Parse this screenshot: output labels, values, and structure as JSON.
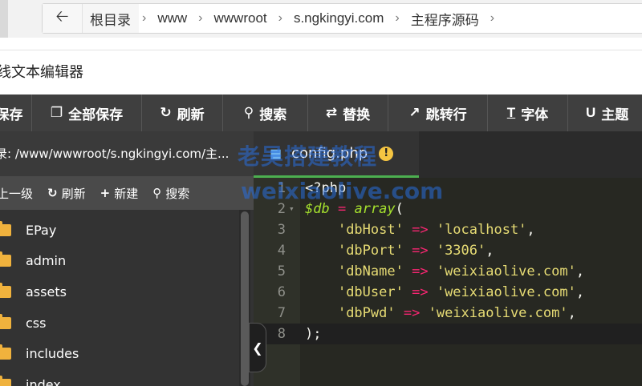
{
  "breadcrumb": {
    "back_icon": "back-arrow-icon",
    "items": [
      "根目录",
      "www",
      "wwwroot",
      "s.ngkingyi.com",
      "主程序源码"
    ]
  },
  "dialog": {
    "title": "线文本编辑器"
  },
  "toolbar": {
    "buttons": [
      {
        "label": "保存",
        "icon": "save-icon"
      },
      {
        "label": "全部保存",
        "icon": "save-all-icon"
      },
      {
        "label": "刷新",
        "icon": "refresh-icon"
      },
      {
        "label": "搜索",
        "icon": "search-icon"
      },
      {
        "label": "替换",
        "icon": "replace-icon"
      },
      {
        "label": "跳转行",
        "icon": "pin-icon"
      },
      {
        "label": "字体",
        "icon": "font-icon"
      },
      {
        "label": "主题",
        "icon": "magnet-icon"
      }
    ]
  },
  "sidebar": {
    "dir_label": "录: /www/wwwroot/s.ngkingyi.com/主...",
    "actions": [
      {
        "label": "上一级",
        "icon": "up-icon"
      },
      {
        "label": "刷新",
        "icon": "refresh-icon"
      },
      {
        "label": "新建",
        "icon": "plus-icon"
      },
      {
        "label": "搜索",
        "icon": "search-icon"
      }
    ],
    "files": [
      "EPay",
      "admin",
      "assets",
      "css",
      "includes",
      "index"
    ]
  },
  "editor": {
    "tab": {
      "name": "config.php",
      "warning": "!"
    },
    "lines": [
      {
        "n": "1",
        "tokens": [
          {
            "t": "<?php",
            "c": "plain"
          }
        ]
      },
      {
        "n": "2",
        "fold": "▾",
        "tokens": [
          {
            "t": "$db",
            "c": "var"
          },
          {
            "t": " ",
            "c": "plain"
          },
          {
            "t": "=",
            "c": "kw"
          },
          {
            "t": " ",
            "c": "plain"
          },
          {
            "t": "array",
            "c": "var"
          },
          {
            "t": "(",
            "c": "plain"
          }
        ]
      },
      {
        "n": "3",
        "tokens": [
          {
            "t": "    ",
            "c": "plain"
          },
          {
            "t": "'dbHost'",
            "c": "str"
          },
          {
            "t": " ",
            "c": "plain"
          },
          {
            "t": "=>",
            "c": "kw"
          },
          {
            "t": " ",
            "c": "plain"
          },
          {
            "t": "'localhost'",
            "c": "str"
          },
          {
            "t": ",",
            "c": "plain"
          }
        ]
      },
      {
        "n": "4",
        "tokens": [
          {
            "t": "    ",
            "c": "plain"
          },
          {
            "t": "'dbPort'",
            "c": "str"
          },
          {
            "t": " ",
            "c": "plain"
          },
          {
            "t": "=>",
            "c": "kw"
          },
          {
            "t": " ",
            "c": "plain"
          },
          {
            "t": "'3306'",
            "c": "str"
          },
          {
            "t": ",",
            "c": "plain"
          }
        ]
      },
      {
        "n": "5",
        "tokens": [
          {
            "t": "    ",
            "c": "plain"
          },
          {
            "t": "'dbName'",
            "c": "str"
          },
          {
            "t": " ",
            "c": "plain"
          },
          {
            "t": "=>",
            "c": "kw"
          },
          {
            "t": " ",
            "c": "plain"
          },
          {
            "t": "'weixiaolive.com'",
            "c": "str"
          },
          {
            "t": ",",
            "c": "plain"
          }
        ]
      },
      {
        "n": "6",
        "tokens": [
          {
            "t": "    ",
            "c": "plain"
          },
          {
            "t": "'dbUser'",
            "c": "str"
          },
          {
            "t": " ",
            "c": "plain"
          },
          {
            "t": "=>",
            "c": "kw"
          },
          {
            "t": " ",
            "c": "plain"
          },
          {
            "t": "'weixiaolive.com'",
            "c": "str"
          },
          {
            "t": ",",
            "c": "plain"
          }
        ]
      },
      {
        "n": "7",
        "tokens": [
          {
            "t": "    ",
            "c": "plain"
          },
          {
            "t": "'dbPwd'",
            "c": "str"
          },
          {
            "t": " ",
            "c": "plain"
          },
          {
            "t": "=>",
            "c": "kw"
          },
          {
            "t": " ",
            "c": "plain"
          },
          {
            "t": "'weixiaolive.com'",
            "c": "str"
          },
          {
            "t": ",",
            "c": "plain"
          }
        ]
      },
      {
        "n": "8",
        "tokens": [
          {
            "t": ");",
            "c": "plain"
          }
        ],
        "active": true
      }
    ]
  },
  "watermark": {
    "line1": "老吴搭建教程",
    "line2": "weixiaolive.com"
  },
  "colors": {
    "toolbar_bg": "#3f3f3f",
    "editor_bg": "#272822",
    "tab_underline": "#4caf50",
    "folder": "#f0b23d"
  }
}
